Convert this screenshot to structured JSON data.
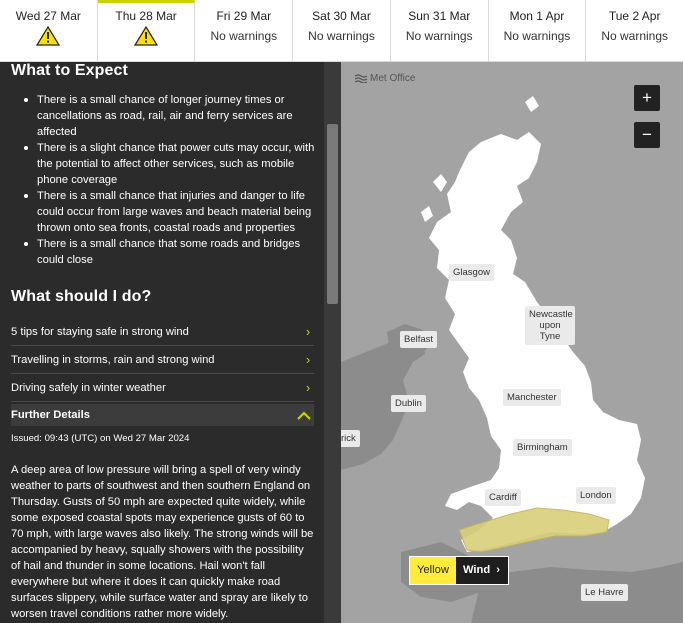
{
  "days": [
    {
      "date": "Wed 27 Mar",
      "status": "",
      "warning": true,
      "active": false
    },
    {
      "date": "Thu 28 Mar",
      "status": "",
      "warning": true,
      "active": true
    },
    {
      "date": "Fri 29 Mar",
      "status": "No warnings",
      "warning": false,
      "active": false
    },
    {
      "date": "Sat 30 Mar",
      "status": "No warnings",
      "warning": false,
      "active": false
    },
    {
      "date": "Sun 31 Mar",
      "status": "No warnings",
      "warning": false,
      "active": false
    },
    {
      "date": "Mon 1 Apr",
      "status": "No warnings",
      "warning": false,
      "active": false
    },
    {
      "date": "Tue 2 Apr",
      "status": "No warnings",
      "warning": false,
      "active": false
    }
  ],
  "panel": {
    "expect_title": "What to Expect",
    "expect_items": [
      "There is a small chance of longer journey times or cancellations as road, rail, air and ferry services are affected",
      "There is a slight chance that power cuts may occur, with the potential to affect other services, such as mobile phone coverage",
      "There is a small chance that injuries and danger to life could occur from large waves and beach material being thrown onto sea fronts, coastal roads and properties",
      "There is a small chance that some roads and bridges could close"
    ],
    "should_title": "What should I do?",
    "links": [
      "5 tips for staying safe in strong wind",
      "Travelling in storms, rain and strong wind",
      "Driving safely in winter weather"
    ],
    "further_label": "Further Details",
    "issued": "Issued: 09:43 (UTC) on Wed 27 Mar 2024",
    "details": "A deep area of low pressure will bring a spell of very windy weather to parts of southwest and then southern England on Thursday. Gusts of  50 mph are expected quite widely, while some exposed coastal spots may experience gusts of 60 to 70 mph, with large waves also likely. The strong winds will be accompanied by heavy, squally showers with the possibility of hail and thunder in some locations. Hail won't fall everywhere but where it does it can quickly make road surfaces slippery, while surface water and spray are likely to worsen travel conditions rather more widely."
  },
  "map": {
    "brand": "Met Office",
    "zoom_in": "+",
    "zoom_out": "−",
    "cities": {
      "glasgow": "Glasgow",
      "newcastle": "Newcastle upon Tyne",
      "belfast": "Belfast",
      "dublin": "Dublin",
      "manchester": "Manchester",
      "limerick": "rick",
      "birmingham": "Birmingham",
      "cardiff": "Cardiff",
      "london": "London",
      "lehavre": "Le Havre"
    },
    "warning_level": "Yellow",
    "warning_type": "Wind",
    "warning_color": "#ffeb3b"
  }
}
